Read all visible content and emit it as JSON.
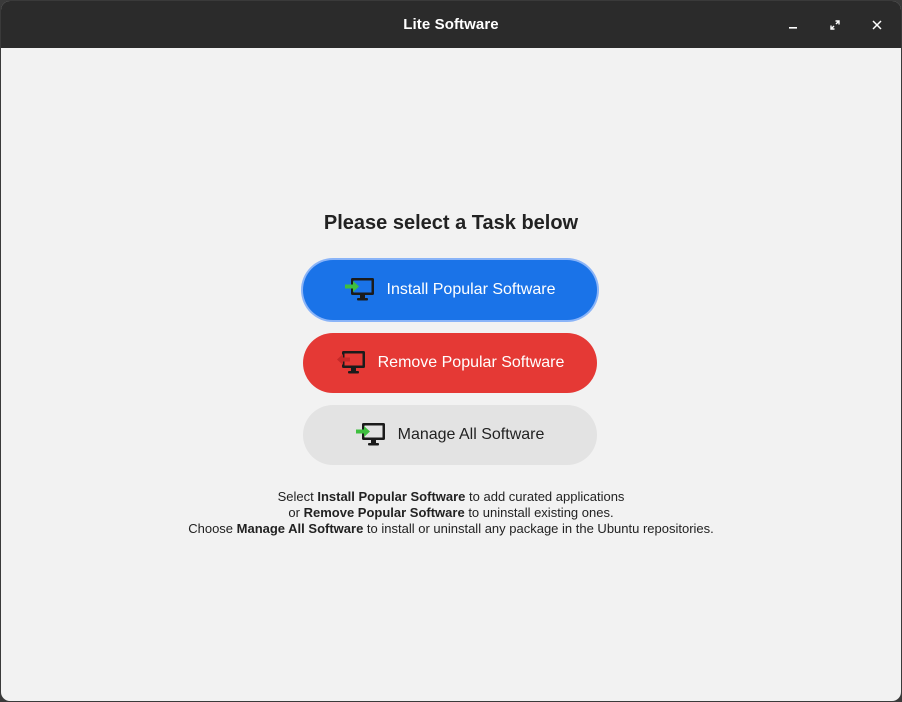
{
  "window": {
    "title": "Lite Software",
    "controls": {
      "minimize": "minimize-icon",
      "maximize": "maximize-icon",
      "close": "close-icon"
    }
  },
  "main": {
    "heading": "Please select a Task below",
    "buttons": {
      "install": {
        "label": "Install Popular Software",
        "icon": "monitor-install-icon",
        "color": "#1a73e8"
      },
      "remove": {
        "label": "Remove Popular Software",
        "icon": "monitor-remove-icon",
        "color": "#e53935"
      },
      "manage": {
        "label": "Manage All Software",
        "icon": "monitor-manage-icon",
        "color": "#e3e3e3"
      }
    },
    "description": {
      "line1": {
        "pre": "Select ",
        "bold": "Install Popular Software",
        "post": " to add curated applications"
      },
      "line2": {
        "pre": "or ",
        "bold": "Remove Popular Software",
        "post": " to uninstall existing ones."
      },
      "line3": {
        "pre": "Choose ",
        "bold": "Manage All Software",
        "post": " to install or uninstall any package in the Ubuntu repositories."
      }
    }
  }
}
